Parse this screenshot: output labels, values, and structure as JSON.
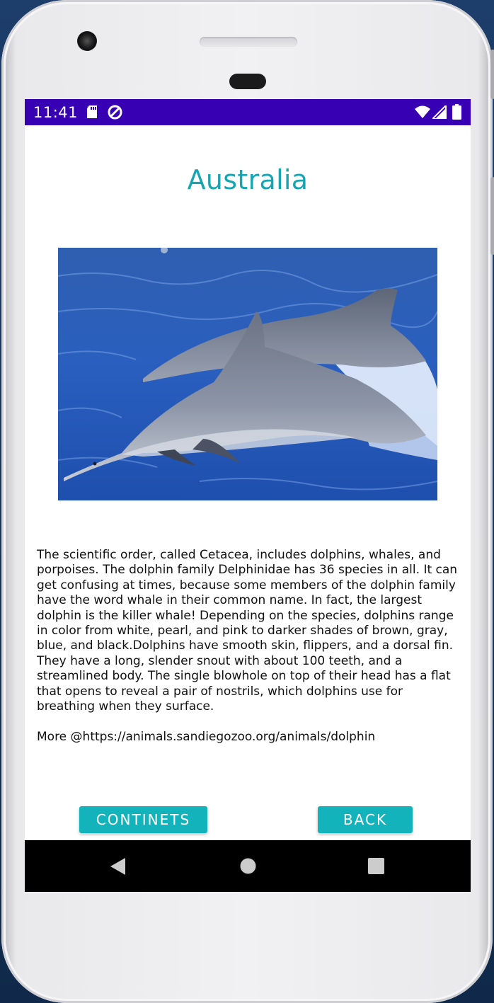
{
  "status_bar": {
    "time": "11:41",
    "left_icons": [
      "sd-card-icon",
      "data-saver-icon"
    ],
    "right_icons": [
      "wifi-icon",
      "signal-icon",
      "battery-icon"
    ],
    "color": "#3700b3"
  },
  "main": {
    "title": "Australia",
    "image_alt": "Dolphins leaping from the ocean",
    "description": "The scientific order, called Cetacea, includes dolphins, whales, and porpoises. The dolphin family Delphinidae has 36 species in all. It can get confusing at times, because some members of the dolphin family have the word whale in their common name. In fact, the largest dolphin is the killer whale! Depending on the species, dolphins range in color from white, pearl, and pink to darker shades of brown, gray, blue, and black.Dolphins have smooth skin, flippers, and a dorsal fin. They have a long, slender snout with about 100 teeth, and a streamlined body. The single blowhole on top of their head has a flat that opens to reveal a pair of nostrils, which dolphins use for breathing when they surface.",
    "more": "More @https://animals.sandiegozoo.org/animals/dolphin"
  },
  "buttons": {
    "continents_label": "CONTINETS",
    "back_label": "BACK"
  },
  "nav_bar": {
    "icons": [
      "back-triangle-icon",
      "home-circle-icon",
      "recents-square-icon"
    ]
  },
  "colors": {
    "accent": "#17a5b1",
    "button": "#12b3ba",
    "status_bar": "#3700b3",
    "nav_bar": "#000000"
  }
}
